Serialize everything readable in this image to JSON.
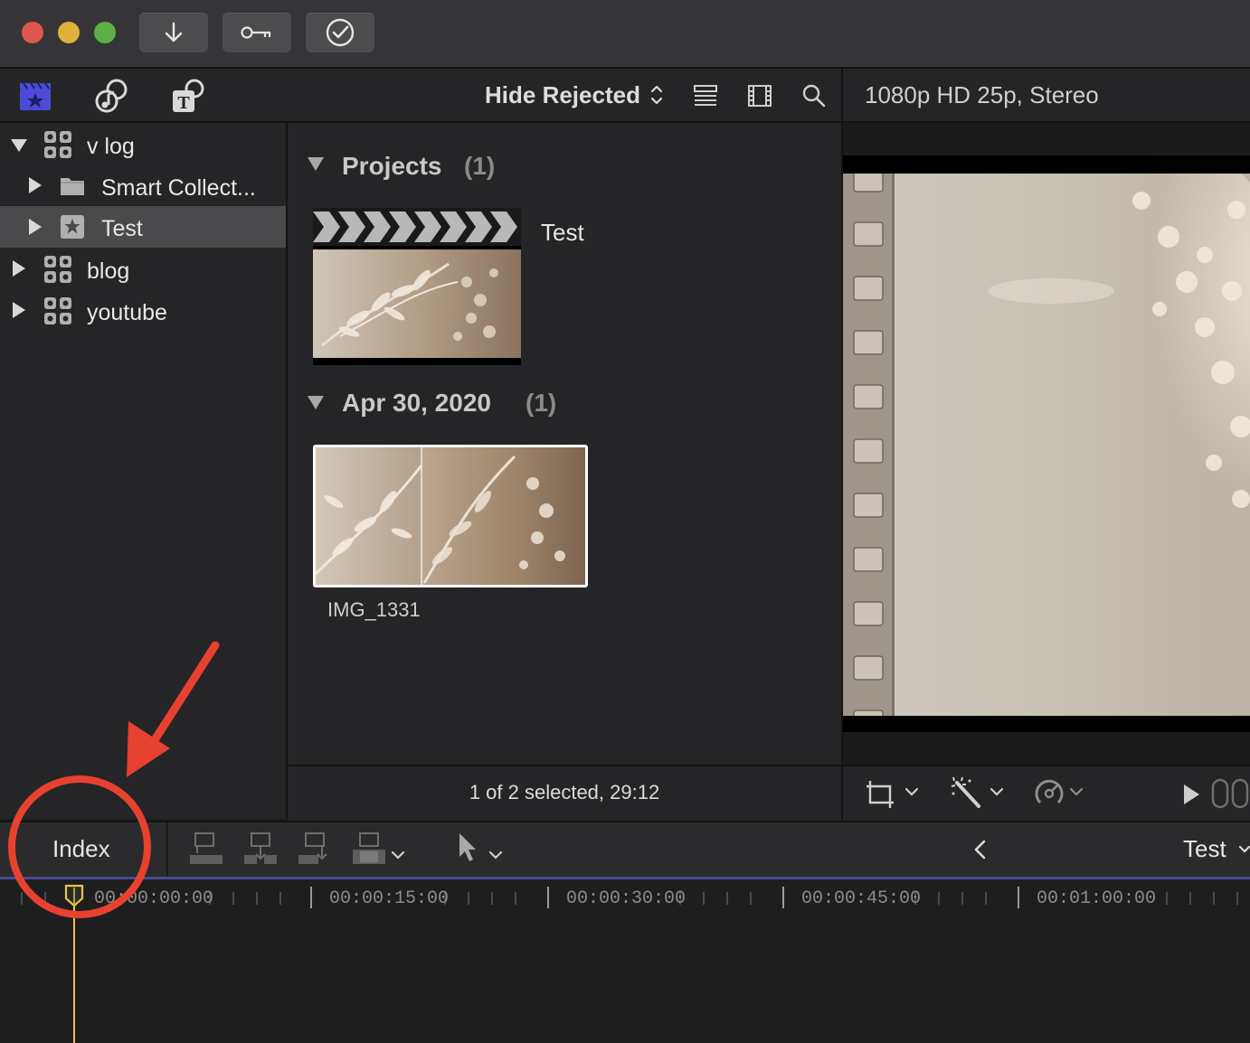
{
  "titlebar": {
    "buttons": [
      {
        "name": "import-button",
        "icon": "download-arrow-icon"
      },
      {
        "name": "keywords-button",
        "icon": "key-icon"
      },
      {
        "name": "background-tasks-button",
        "icon": "checkmark-circle-icon"
      }
    ]
  },
  "browser_toolbar": {
    "filter_label": "Hide Rejected",
    "icons": [
      "libraries-icon",
      "photos-audio-icon",
      "titles-generators-icon",
      "clip-appearance-icon",
      "filmstrip-icon",
      "search-icon"
    ]
  },
  "viewer": {
    "format_label": "1080p HD 25p, Stereo"
  },
  "sidebar": {
    "items": [
      {
        "label": "v log",
        "type": "library",
        "expanded": true
      },
      {
        "label": "Smart Collect...",
        "type": "folder",
        "expanded": false
      },
      {
        "label": "Test",
        "type": "event",
        "expanded": false,
        "selected": true
      },
      {
        "label": "blog",
        "type": "library",
        "expanded": false
      },
      {
        "label": "youtube",
        "type": "library",
        "expanded": false
      }
    ]
  },
  "browser": {
    "sections": [
      {
        "title": "Projects",
        "count": "(1)",
        "items": [
          {
            "label": "Test",
            "type": "project"
          }
        ]
      },
      {
        "title": "Apr 30, 2020",
        "count": "(1)",
        "items": [
          {
            "label": "IMG_1331",
            "type": "clip"
          }
        ]
      }
    ],
    "status": "1 of 2 selected, 29:12"
  },
  "timeline": {
    "index_label": "Index",
    "project_name": "Test",
    "back_label": "<",
    "timecodes": [
      "00:00:00:00",
      "00:00:15:00",
      "00:00:30:00",
      "00:00:45:00",
      "00:01:00:00"
    ]
  },
  "colors": {
    "annotation": "#e8412f",
    "playhead": "#e8c547",
    "accent": "#5a5ad6"
  }
}
